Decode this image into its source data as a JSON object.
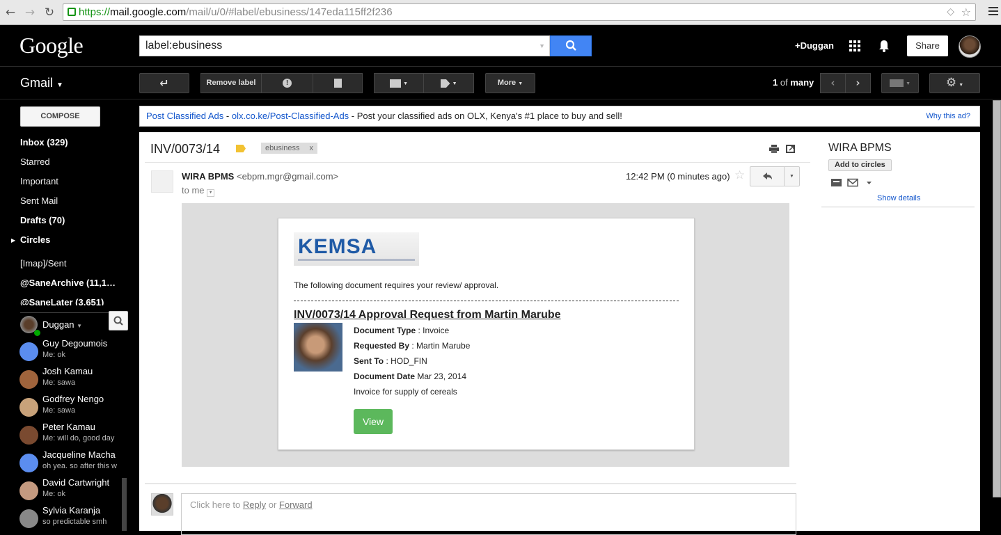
{
  "browser": {
    "url_scheme": "https://",
    "url_host": "mail.google.com",
    "url_path": "/mail/u/0/#label/ebusiness/147eda115ff2f236"
  },
  "gbar": {
    "logo": "Google",
    "search_value": "label:ebusiness",
    "user": "+Duggan",
    "share": "Share"
  },
  "toolbar": {
    "app": "Gmail",
    "remove_label": "Remove label",
    "more": "More",
    "pager_current": "1",
    "pager_of": "of",
    "pager_total": "many"
  },
  "nav": {
    "compose": "COMPOSE",
    "items": [
      "Inbox (329)",
      "Starred",
      "Important",
      "Sent Mail",
      "Drafts (70)",
      "Circles",
      "[Imap]/Sent",
      "@SaneArchive (11,1…",
      "@SaneLater (3,651)"
    ]
  },
  "chat": {
    "me": "Duggan",
    "contacts": [
      {
        "name": "Guy Degoumois",
        "msg": "Me: ok",
        "color": "#5b8def"
      },
      {
        "name": "Josh Kamau",
        "msg": "Me: sawa",
        "color": "#a0643c"
      },
      {
        "name": "Godfrey Nengo",
        "msg": "Me: sawa",
        "color": "#c8a27a"
      },
      {
        "name": "Peter Kamau",
        "msg": "Me: will do, good day",
        "color": "#7a4a30"
      },
      {
        "name": "Jacqueline Macha",
        "msg": "oh yea. so after this w",
        "color": "#5b8def"
      },
      {
        "name": "David Cartwright",
        "msg": "Me: ok",
        "color": "#c49a80"
      },
      {
        "name": "Sylvia Karanja",
        "msg": "so predictable smh",
        "color": "#888"
      }
    ]
  },
  "ad": {
    "title": "Post Classified Ads",
    "dash1": " - ",
    "link": "olx.co.ke/Post-Classified-Ads",
    "text": " - Post your classified ads on OLX, Kenya's #1 place to buy and sell!",
    "why": "Why this ad?"
  },
  "message": {
    "subject": "INV/0073/14",
    "label": "ebusiness",
    "label_remove": "x",
    "sender": "WIRA BPMS",
    "sender_email": "<ebpm.mgr@gmail.com>",
    "to": "to me",
    "date": "12:42 PM (0 minutes ago)",
    "body": {
      "logo": "KEMSA",
      "intro": "The following document requires your review/ approval.",
      "title": "INV/0073/14 Approval Request from Martin Marube",
      "fields": [
        {
          "label": "Document Type",
          "sep": " : ",
          "value": "Invoice"
        },
        {
          "label": "Requested By",
          "sep": " : ",
          "value": "Martin Marube"
        },
        {
          "label": "Sent To",
          "sep": " : ",
          "value": "HOD_FIN"
        },
        {
          "label": "Document Date",
          "sep": " ",
          "value": "Mar 23, 2014"
        }
      ],
      "description": "Invoice for supply of cereals",
      "view": "View"
    },
    "reply_prefix": "Click here to ",
    "reply": "Reply",
    "reply_or": " or ",
    "forward": "Forward"
  },
  "sidebar": {
    "name": "WIRA BPMS",
    "add_circles": "Add to circles",
    "show_details": "Show details"
  }
}
